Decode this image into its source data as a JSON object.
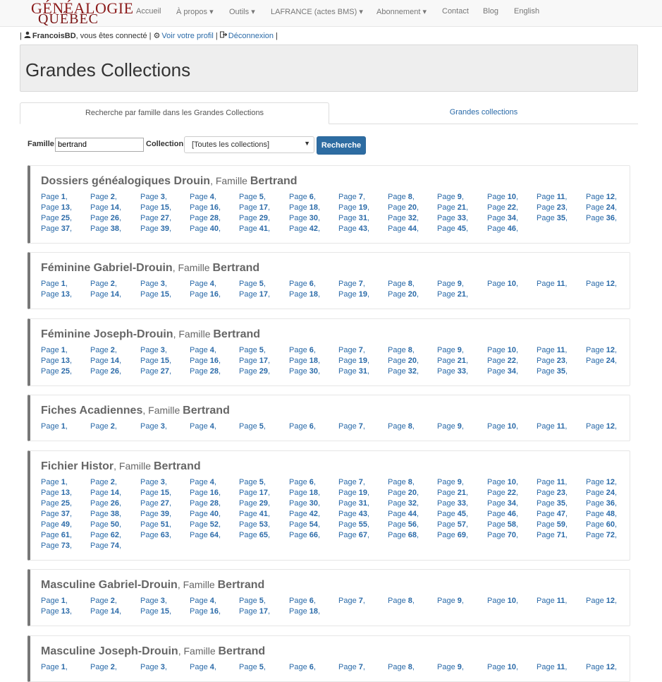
{
  "logo": {
    "line1": "GÉNÉALOGIE",
    "line2": "QUÉBEC"
  },
  "nav": [
    {
      "label": "Accueil",
      "caret": false
    },
    {
      "label": "À propos",
      "caret": true
    },
    {
      "label": "Outils",
      "caret": true
    },
    {
      "label": "LAFRANCE (actes BMS)",
      "caret": true
    },
    {
      "label": "Abonnement",
      "caret": true
    },
    {
      "label": "Contact",
      "caret": false
    },
    {
      "label": "Blog",
      "caret": false
    },
    {
      "label": "English",
      "caret": false
    }
  ],
  "userbar": {
    "username": "FrancoisBD",
    "connected_text": ", vous êtes connecté |",
    "profile_link": "Voir votre profil",
    "logout_link": "Déconnexion",
    "sep": "|"
  },
  "page_title": "Grandes Collections",
  "tabs": [
    {
      "label": "Recherche par famille dans les Grandes Collections",
      "active": true
    },
    {
      "label": "Grandes collections",
      "active": false
    }
  ],
  "search": {
    "famille_label": "Famille",
    "famille_value": "bertrand",
    "collection_label": "Collection",
    "collection_selected": "[Toutes les collections]",
    "button_label": "Recherche"
  },
  "panels": [
    {
      "collection": "Dossiers généalogiques Drouin",
      "famille_text": ", Famille ",
      "family_name": "Bertrand",
      "page_count": 46
    },
    {
      "collection": "Féminine Gabriel-Drouin",
      "famille_text": ", Famille ",
      "family_name": "Bertrand",
      "page_count": 21
    },
    {
      "collection": "Féminine Joseph-Drouin",
      "famille_text": ", Famille ",
      "family_name": "Bertrand",
      "page_count": 35
    },
    {
      "collection": "Fiches Acadiennes",
      "famille_text": ", Famille ",
      "family_name": "Bertrand",
      "page_count": 12
    },
    {
      "collection": "Fichier Histor",
      "famille_text": ", Famille ",
      "family_name": "Bertrand",
      "page_count": 74
    },
    {
      "collection": "Masculine Gabriel-Drouin",
      "famille_text": ", Famille ",
      "family_name": "Bertrand",
      "page_count": 18
    },
    {
      "collection": "Masculine Joseph-Drouin",
      "famille_text": ", Famille ",
      "family_name": "Bertrand",
      "page_count": 12
    }
  ],
  "page_word": "Page"
}
